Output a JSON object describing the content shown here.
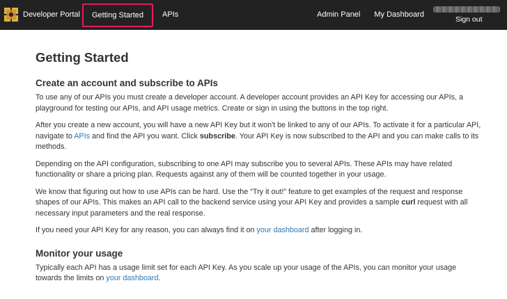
{
  "header": {
    "brand": "Developer Portal",
    "nav_left": [
      "Getting Started",
      "APIs"
    ],
    "active_nav": "Getting Started",
    "nav_right": [
      "Admin Panel",
      "My Dashboard"
    ],
    "signout": "Sign out",
    "colors": {
      "bar": "#222222",
      "highlight": "#e31c5f",
      "link": "#2a7ab6",
      "logo": "#e1b04a"
    }
  },
  "content": {
    "title": "Getting Started",
    "section1": {
      "heading": "Create an account and subscribe to APIs",
      "p1": "To use any of our APIs you must create a developer account. A developer account provides an API Key for accessing our APIs, a playground for testing our APIs, and API usage metrics. Create or sign in using the buttons in the top right.",
      "p2": {
        "before": "After you create a new account, you will have a new API Key but it won't be linked to any of our APIs. To activate it for a particular API, navigate to ",
        "link": "APIs",
        "middle": " and find the API you want. Click ",
        "bold": "subscribe",
        "after": ". Your API Key is now subscribed to the API and you can make calls to its methods."
      },
      "p3": "Depending on the API configuration, subscribing to one API may subscribe you to several APIs. These APIs may have related functionality or share a pricing plan. Requests against any of them will be counted together in your usage.",
      "p4": {
        "before": "We know that figuring out how to use APIs can be hard. Use the “Try it out!” feature to get examples of the request and response shapes of our APIs. This makes an API call to the backend service using your API Key and provides a sample ",
        "bold": "curl",
        "after": " request with all necessary input parameters and the real response."
      },
      "p5": {
        "before": "If you need your API Key for any reason, you can always find it on ",
        "link": "your dashboard",
        "after": " after logging in."
      }
    },
    "section2": {
      "heading": "Monitor your usage",
      "p1": {
        "before": "Typically each API has a usage limit set for each API Key. As you scale up your usage of the APIs, you can monitor your usage towards the limits on ",
        "link": "your dashboard",
        "after": "."
      }
    }
  }
}
